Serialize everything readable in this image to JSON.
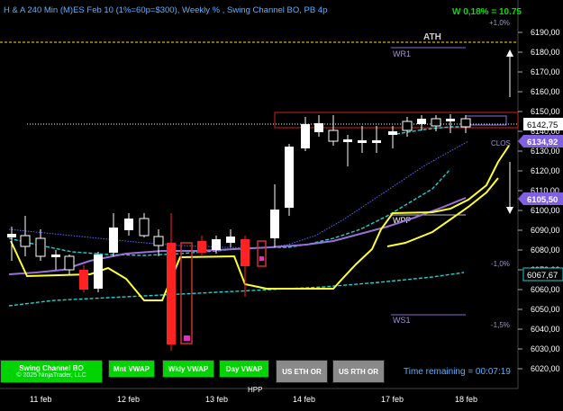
{
  "header": {
    "title": "H & A 240 Min (M)ES Feb 10  (1%=60p=$300), Weekly % , Swing Channel BO, PB 4p",
    "pnl": "W 0,18% = 10.75"
  },
  "price_axis": {
    "ticks": [
      "6190,00",
      "6180,00",
      "6170,00",
      "6160,00",
      "6150,00",
      "6140,00",
      "6130,00",
      "6120,00",
      "6110,00",
      "6100,00",
      "6090,00",
      "6080,00",
      "6070,00",
      "6060,00",
      "6050,00",
      "6040,00",
      "6030,00",
      "6020,00"
    ],
    "markers": {
      "last": "6142,75",
      "upper": "6134,92",
      "middle": "6105,50",
      "lower": "6067,67"
    }
  },
  "time_axis": {
    "labels": [
      "11 feb",
      "12 feb",
      "13 feb",
      "14 feb",
      "17 feb",
      "18 feb"
    ]
  },
  "levels": {
    "ath": "ATH",
    "wr1": "WR1",
    "wpp": "WPP",
    "ws1": "WS1",
    "clos": "CLOS",
    "pct_plus1": "+1,0%",
    "pct_minus1": "-1,0%",
    "pct_minus15": "-1,5%",
    "hpp": "HPP"
  },
  "buttons": {
    "swing": "Swing Channel BO",
    "swing_sub": "© 2025 NinjaTrader, LLC",
    "mnt_vwap": "Mnt VWAP",
    "wkly_vwap": "Wkly VWAP",
    "day_vwap": "Day VWAP",
    "us_eth": "US ETH OR",
    "us_rth": "US RTH OR"
  },
  "status": {
    "time_remaining": "Time remaining = 00:07:19"
  },
  "colors": {
    "background": "#000000",
    "ath_line": "#d4b400",
    "vwap_purple": "#9a70d8",
    "cyan_band": "#20d0d0",
    "yellow_channel": "#ffff30",
    "marker_purple": "#8060e0",
    "button_green": "#00d400",
    "button_gray": "#8a8a8a",
    "header_blue": "#5ab0ff"
  }
}
